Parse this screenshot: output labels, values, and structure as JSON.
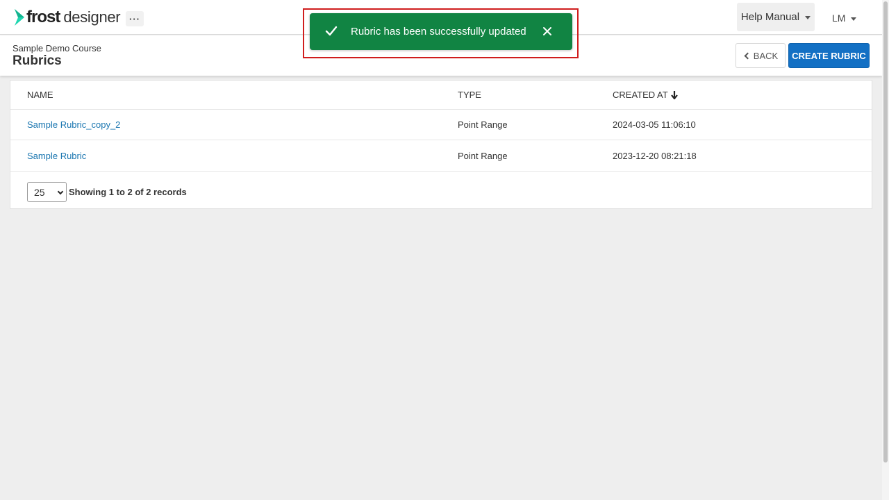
{
  "app": {
    "logo_word_1": "frost",
    "logo_word_2": "designer",
    "more_label": "···",
    "help_label": "Help Manual",
    "user_initials": "LM",
    "brand_color": "#1fd6b0",
    "primary_color": "#1370c4"
  },
  "header": {
    "course": "Sample Demo Course",
    "title": "Rubrics",
    "back_label": "BACK",
    "create_label": "CREATE RUBRIC"
  },
  "table": {
    "columns": [
      "NAME",
      "TYPE",
      "CREATED AT"
    ],
    "sort_column": "CREATED AT",
    "sort_direction": "descending",
    "rows": [
      {
        "name": "Sample Rubric_copy_2",
        "type": "Point Range",
        "created": "2024-03-05 11:06:10"
      },
      {
        "name": "Sample Rubric",
        "type": "Point Range",
        "created": "2023-12-20 08:21:18"
      }
    ],
    "page_size": "25",
    "records_text": "Showing 1 to 2 of 2 records"
  },
  "toast": {
    "message": "Rubric has been successfully updated",
    "color": "#118443",
    "highlight_color": "#d01d1d",
    "icon": "check-icon"
  }
}
